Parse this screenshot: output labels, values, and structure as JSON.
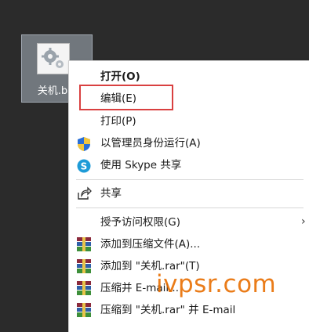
{
  "desktop_icon": {
    "label": "关机.bat"
  },
  "context_menu": {
    "items": [
      {
        "label": "打开(O)"
      },
      {
        "label": "编辑(E)"
      },
      {
        "label": "打印(P)"
      },
      {
        "label": "以管理员身份运行(A)"
      },
      {
        "label": "使用 Skype 共享"
      },
      {
        "label": "共享"
      },
      {
        "label": "授予访问权限(G)"
      },
      {
        "label": "添加到压缩文件(A)..."
      },
      {
        "label": "添加到 \"关机.rar\"(T)"
      },
      {
        "label": "压缩并 E-mail..."
      },
      {
        "label": "压缩到 \"关机.rar\" 并 E-mail"
      }
    ]
  },
  "watermark": {
    "text": "ivpsr.com"
  },
  "colors": {
    "desktop_bg": "#2b2b2b",
    "highlight": "#d94040",
    "watermark": "#e86e00"
  }
}
